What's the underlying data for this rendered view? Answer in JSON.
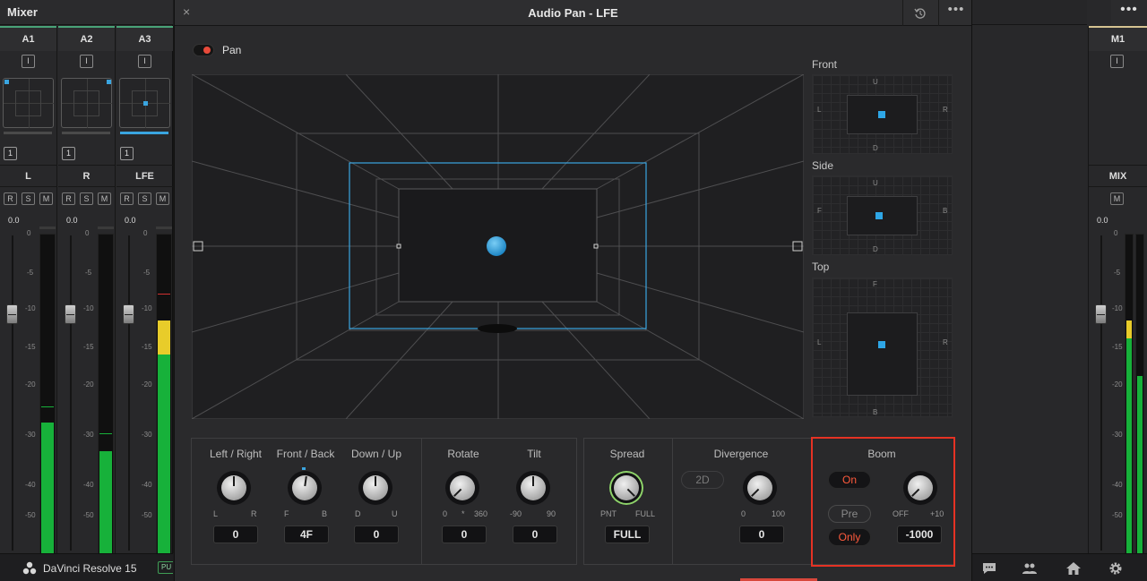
{
  "mixer": {
    "title": "Mixer",
    "strips": [
      {
        "name": "A1",
        "input": "I",
        "track_no": "1",
        "channel": "L",
        "rsm": [
          "R",
          "S",
          "M"
        ],
        "gain": "0.0"
      },
      {
        "name": "A2",
        "input": "I",
        "track_no": "1",
        "channel": "R",
        "rsm": [
          "R",
          "S",
          "M"
        ],
        "gain": "0.0"
      },
      {
        "name": "A3",
        "input": "I",
        "track_no": "1",
        "channel": "LFE",
        "rsm": [
          "R",
          "S",
          "M"
        ],
        "gain": "0.0"
      }
    ],
    "scale": [
      "0",
      "-5",
      "-10",
      "-15",
      "-20",
      "-30",
      "-40",
      "-50"
    ]
  },
  "master": {
    "name": "M1",
    "input": "I",
    "channel": "MIX",
    "mute": "M",
    "gain": "0.0"
  },
  "footer": {
    "app_name": "DaVinci Resolve 15",
    "badge": "PU"
  },
  "pan": {
    "title": "Audio Pan - LFE",
    "close_icon": "×",
    "more_icon": "•••",
    "pan_label": "Pan",
    "views": {
      "front": {
        "label": "Front",
        "top": "U",
        "bottom": "D",
        "left": "L",
        "right": "R"
      },
      "side": {
        "label": "Side",
        "top": "U",
        "bottom": "D",
        "left": "F",
        "right": "B"
      },
      "top": {
        "label": "Top",
        "top": "F",
        "bottom": "B",
        "left": "L",
        "right": "R"
      }
    },
    "controls": {
      "left_right": {
        "label": "Left / Right",
        "min": "L",
        "max": "R",
        "value": "0"
      },
      "front_back": {
        "label": "Front / Back",
        "min": "F",
        "max": "B",
        "value": "4F"
      },
      "down_up": {
        "label": "Down / Up",
        "min": "D",
        "max": "U",
        "value": "0"
      },
      "rotate": {
        "label": "Rotate",
        "min": "0",
        "mid": "*",
        "max": "360",
        "value": "0"
      },
      "tilt": {
        "label": "Tilt",
        "min": "-90",
        "max": "90",
        "value": "0"
      },
      "spread": {
        "label": "Spread",
        "min": "PNT",
        "max": "FULL",
        "value": "FULL"
      },
      "divergence": {
        "label": "Divergence",
        "mode": "2D",
        "min": "0",
        "max": "100",
        "value": "0"
      },
      "boom": {
        "label": "Boom",
        "on": "On",
        "pre": "Pre",
        "only": "Only",
        "min": "OFF",
        "max": "+10",
        "value": "-1000"
      }
    }
  },
  "colors": {
    "accent_blue": "#2ea6e6",
    "meter_green": "#17b13a",
    "highlight_red": "#e53224",
    "active_red": "#ff5a3c"
  }
}
